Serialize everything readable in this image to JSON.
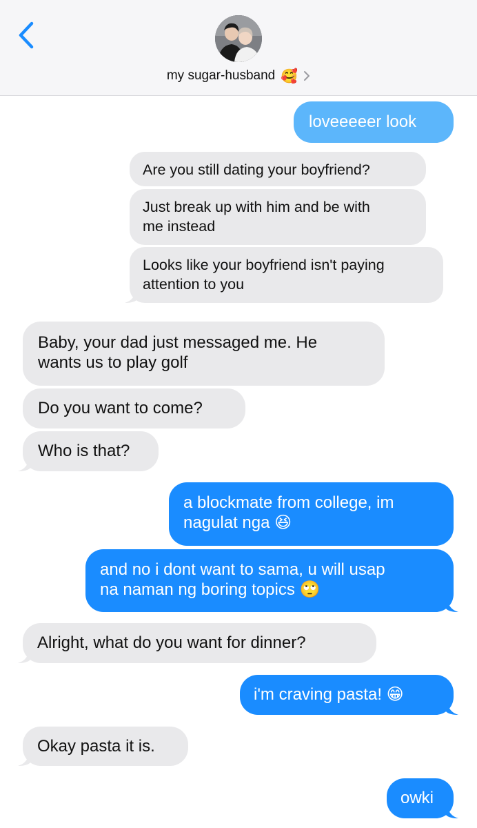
{
  "header": {
    "contact_name": "my sugar-husband",
    "contact_emoji": "🥰",
    "back_icon": "chevron-left-icon",
    "detail_icon": "chevron-right-icon",
    "accent_color": "#1a8cff"
  },
  "messages": [
    {
      "dir": "out",
      "lines": [
        "loveeeeer look"
      ]
    },
    {
      "dir": "in",
      "lines": [
        "Are you still dating your boyfriend?"
      ]
    },
    {
      "dir": "in",
      "lines": [
        "Just break up with him and be with",
        "me instead"
      ]
    },
    {
      "dir": "in",
      "lines": [
        "Looks like your boyfriend isn't paying",
        "attention to you"
      ]
    },
    {
      "dir": "in",
      "lines": [
        "Baby, your dad just messaged me. He",
        "wants us to play golf"
      ]
    },
    {
      "dir": "in",
      "lines": [
        "Do you want to come?"
      ]
    },
    {
      "dir": "in",
      "lines": [
        "Who is that?"
      ]
    },
    {
      "dir": "out",
      "lines": [
        "a blockmate from college, im",
        "nagulat nga 😆"
      ]
    },
    {
      "dir": "out",
      "lines": [
        "and no i dont want to sama, u will usap",
        "na naman ng boring topics 🙄"
      ]
    },
    {
      "dir": "in",
      "lines": [
        "Alright, what do you want for dinner?"
      ]
    },
    {
      "dir": "out",
      "lines": [
        "i'm craving pasta! 😁"
      ]
    },
    {
      "dir": "in",
      "lines": [
        "Okay pasta it is."
      ]
    },
    {
      "dir": "out",
      "lines": [
        "owki"
      ]
    }
  ]
}
